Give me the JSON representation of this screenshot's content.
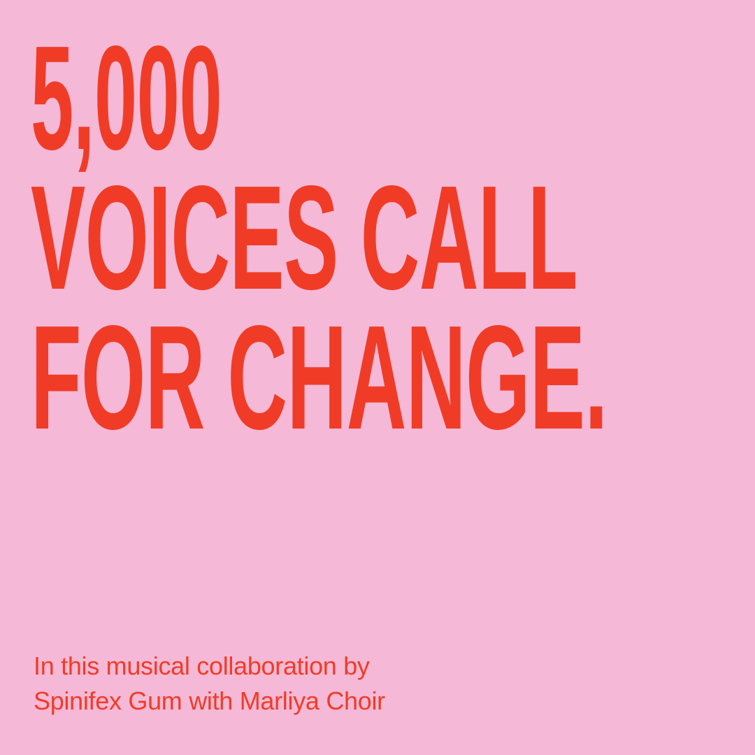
{
  "colors": {
    "background": "#f5b8d6",
    "accent": "#f03c26"
  },
  "headline": {
    "lines": [
      "5,000",
      "VOICES CALL",
      "FOR CHANGE."
    ]
  },
  "subheadline": {
    "lines": [
      "In this musical collaboration by",
      "Spinifex Gum with Marliya Choir"
    ]
  }
}
